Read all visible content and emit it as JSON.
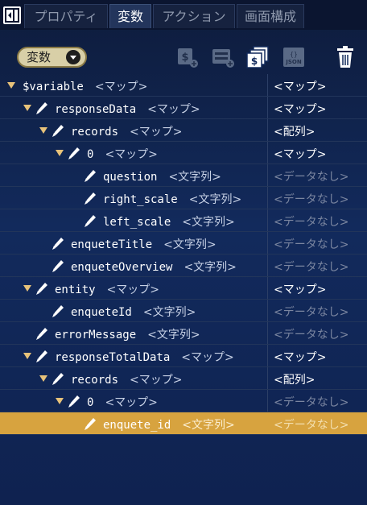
{
  "tabs": [
    {
      "label": "プロパティ"
    },
    {
      "label": "変数"
    },
    {
      "label": "アクション"
    },
    {
      "label": "画面構成"
    }
  ],
  "toolbar": {
    "dropdown_label": "変数",
    "icons": [
      "add-money-variable-icon",
      "add-list-variable-icon",
      "copy-money-icon",
      "json-icon",
      "trash-icon"
    ]
  },
  "tree": [
    {
      "name": "$variable",
      "type": "<マップ>",
      "value": "<マップ>",
      "depth": 0,
      "expandable": true
    },
    {
      "name": "responseData",
      "type": "<マップ>",
      "value": "<マップ>",
      "depth": 1,
      "expandable": true
    },
    {
      "name": "records",
      "type": "<マップ>",
      "value": "<配列>",
      "depth": 2,
      "expandable": true
    },
    {
      "name": "0",
      "type": "<マップ>",
      "value": "<マップ>",
      "depth": 3,
      "expandable": true
    },
    {
      "name": "question",
      "type": "<文字列>",
      "value": "<データなし>",
      "depth": 4,
      "expandable": false
    },
    {
      "name": "right_scale",
      "type": "<文字列>",
      "value": "<データなし>",
      "depth": 4,
      "expandable": false
    },
    {
      "name": "left_scale",
      "type": "<文字列>",
      "value": "<データなし>",
      "depth": 4,
      "expandable": false
    },
    {
      "name": "enqueteTitle",
      "type": "<文字列>",
      "value": "<データなし>",
      "depth": 2,
      "expandable": false
    },
    {
      "name": "enqueteOverview",
      "type": "<文字列>",
      "value": "<データなし>",
      "depth": 2,
      "expandable": false
    },
    {
      "name": "entity",
      "type": "<マップ>",
      "value": "<マップ>",
      "depth": 1,
      "expandable": true
    },
    {
      "name": "enqueteId",
      "type": "<文字列>",
      "value": "<データなし>",
      "depth": 2,
      "expandable": false
    },
    {
      "name": "errorMessage",
      "type": "<文字列>",
      "value": "<データなし>",
      "depth": 1,
      "expandable": false
    },
    {
      "name": "responseTotalData",
      "type": "<マップ>",
      "value": "<マップ>",
      "depth": 1,
      "expandable": true
    },
    {
      "name": "records",
      "type": "<マップ>",
      "value": "<配列>",
      "depth": 2,
      "expandable": true
    },
    {
      "name": "0",
      "type": "<マップ>",
      "value": "<データなし>",
      "depth": 3,
      "expandable": true
    },
    {
      "name": "enquete_id",
      "type": "<文字列>",
      "value": "<データなし>",
      "depth": 4,
      "expandable": false,
      "selected": true
    }
  ],
  "colors": {
    "selected_row": "#d7a33f",
    "background": "#122a5c",
    "empty_value": "#7b86a0"
  }
}
